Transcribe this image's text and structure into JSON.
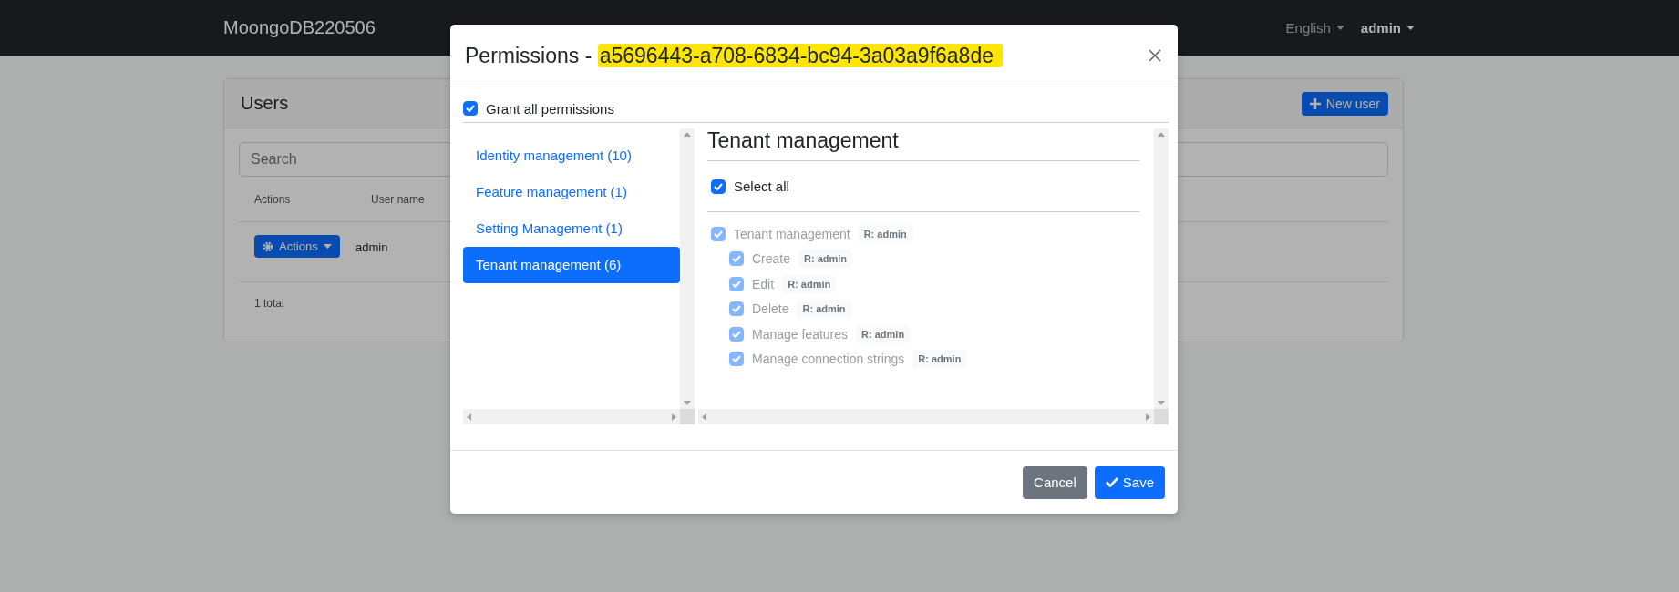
{
  "navbar": {
    "brand": "MoongoDB220506",
    "language": "English",
    "user": "admin"
  },
  "users_card": {
    "title": "Users",
    "new_user_button": "New user",
    "search": {
      "placeholder": "Search"
    },
    "columns": [
      "Actions",
      "User name"
    ],
    "rows": [
      {
        "actions": "Actions",
        "user_name": "admin"
      }
    ],
    "total": "1 total"
  },
  "modal": {
    "title_prefix": "Permissions - ",
    "title_id": "a5696443-a708-6834-bc94-3a03a9f6a8de",
    "grant_all": {
      "label": "Grant all permissions",
      "checked": true
    },
    "groups": [
      {
        "label": "Identity management (10)",
        "selected": false
      },
      {
        "label": "Feature management (1)",
        "selected": false
      },
      {
        "label": "Setting Management (1)",
        "selected": false
      },
      {
        "label": "Tenant management (6)",
        "selected": true
      }
    ],
    "panel_title": "Tenant management",
    "select_all": {
      "label": "Select all",
      "checked": true
    },
    "permissions": [
      {
        "label": "Tenant management",
        "role": "R: admin",
        "checked": true,
        "disabled": true,
        "children": [
          {
            "label": "Create",
            "role": "R: admin",
            "checked": true,
            "disabled": true
          },
          {
            "label": "Edit",
            "role": "R: admin",
            "checked": true,
            "disabled": true
          },
          {
            "label": "Delete",
            "role": "R: admin",
            "checked": true,
            "disabled": true
          },
          {
            "label": "Manage features",
            "role": "R: admin",
            "checked": true,
            "disabled": true
          },
          {
            "label": "Manage connection strings",
            "role": "R: admin",
            "checked": true,
            "disabled": true
          }
        ]
      }
    ],
    "buttons": [
      {
        "kind": "secondary",
        "label": "Cancel"
      },
      {
        "kind": "primary",
        "label": "Save"
      }
    ]
  }
}
